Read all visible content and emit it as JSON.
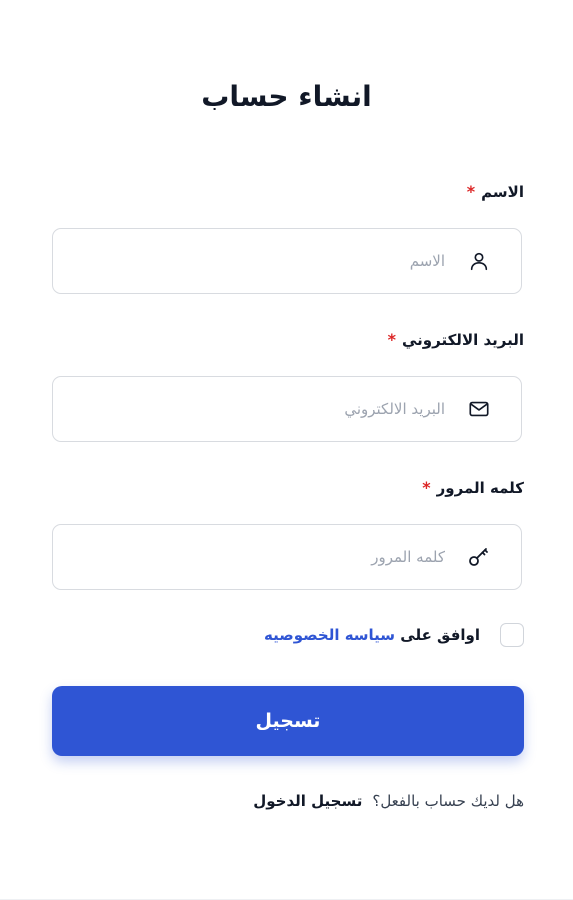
{
  "form": {
    "title": "انشاء حساب",
    "name_field": {
      "label": "الاسم",
      "required_mark": "*",
      "placeholder": "الاسم",
      "value": "",
      "icon": "user-icon"
    },
    "email_field": {
      "label": "البريد الالكتروني",
      "required_mark": "*",
      "placeholder": "البريد الالكتروني",
      "value": "",
      "icon": "mail-icon"
    },
    "password_field": {
      "label": "كلمه المرور",
      "required_mark": "*",
      "placeholder": "كلمه المرور",
      "value": "",
      "icon": "key-icon"
    },
    "agree": {
      "text": "اوافق على",
      "link_text": "سياسه الخصوصيه",
      "checked": false
    },
    "submit_label": "تسجيل",
    "login_prompt": {
      "question": "هل لديك حساب بالفعل؟",
      "link_text": "تسجيل الدخول"
    }
  },
  "colors": {
    "accent": "#2f55d4",
    "required": "#dc2626",
    "border": "#d8dbe0",
    "placeholder": "#9ca3af"
  }
}
